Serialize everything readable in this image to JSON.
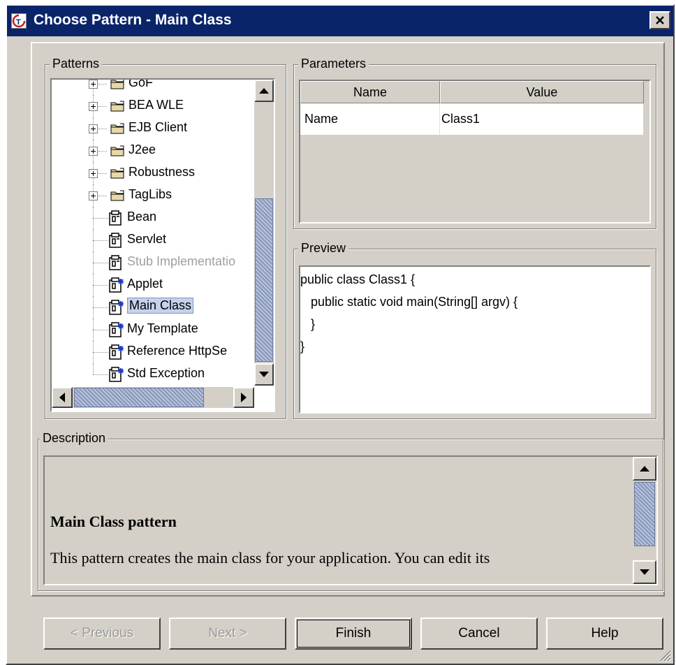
{
  "window": {
    "title": "Choose Pattern - Main Class"
  },
  "patterns": {
    "legend": "Patterns",
    "tree": [
      {
        "label": "GoF",
        "kind": "folder",
        "expandable": true
      },
      {
        "label": "BEA WLE",
        "kind": "folder",
        "expandable": true
      },
      {
        "label": "EJB Client",
        "kind": "folder",
        "expandable": true
      },
      {
        "label": "J2ee",
        "kind": "folder",
        "expandable": true
      },
      {
        "label": "Robustness",
        "kind": "folder",
        "expandable": true
      },
      {
        "label": "TagLibs",
        "kind": "folder",
        "expandable": true
      },
      {
        "label": "Bean",
        "kind": "pattern",
        "icon": "pattern-icon"
      },
      {
        "label": "Servlet",
        "kind": "pattern",
        "icon": "pattern-icon"
      },
      {
        "label": "Stub Implementatio",
        "kind": "pattern",
        "icon": "pattern-icon",
        "disabled": true
      },
      {
        "label": "Applet",
        "kind": "pattern",
        "icon": "template-pattern-icon"
      },
      {
        "label": "Main Class",
        "kind": "pattern",
        "icon": "template-pattern-icon",
        "selected": true
      },
      {
        "label": "My Template",
        "kind": "pattern",
        "icon": "template-pattern-icon"
      },
      {
        "label": "Reference HttpSe",
        "kind": "pattern",
        "icon": "template-pattern-icon"
      },
      {
        "label": "Std Exception",
        "kind": "pattern",
        "icon": "template-pattern-icon"
      }
    ]
  },
  "parameters": {
    "legend": "Parameters",
    "columns": [
      "Name",
      "Value"
    ],
    "rows": [
      {
        "name": "Name",
        "value": "Class1"
      }
    ]
  },
  "preview": {
    "legend": "Preview",
    "lines": [
      "public class Class1 {",
      "   public static void main(String[] argv) {",
      "   }",
      "}"
    ]
  },
  "description": {
    "legend": "Description",
    "heading": "Main Class pattern",
    "text": "This pattern creates the main class for your application. You can edit its"
  },
  "buttons": {
    "previous": "< Previous",
    "next": "Next >",
    "finish": "Finish",
    "cancel": "Cancel",
    "help": "Help"
  },
  "colors": {
    "titlebar": "#0a246a",
    "dialog_bg": "#d4d0c8",
    "selection": "#c5d2ea",
    "scroll_thumb": "#9aa8c8"
  }
}
